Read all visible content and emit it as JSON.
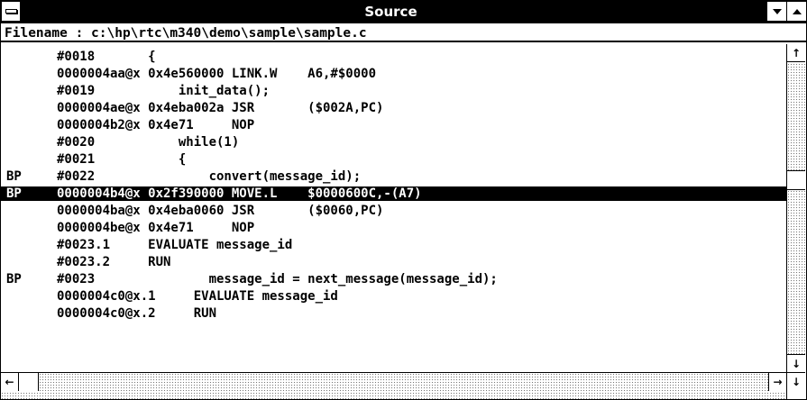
{
  "window": {
    "title": "Source"
  },
  "header": {
    "filename_label": "Filename : c:\\hp\\rtc\\m340\\demo\\sample\\sample.c"
  },
  "lines": [
    {
      "bp": "",
      "text": "#0018       {",
      "highlight": false
    },
    {
      "bp": "",
      "text": "0000004aa@x 0x4e560000 LINK.W    A6,#$0000",
      "highlight": false
    },
    {
      "bp": "",
      "text": "#0019           init_data();",
      "highlight": false
    },
    {
      "bp": "",
      "text": "0000004ae@x 0x4eba002a JSR       ($002A,PC)",
      "highlight": false
    },
    {
      "bp": "",
      "text": "0000004b2@x 0x4e71     NOP",
      "highlight": false
    },
    {
      "bp": "",
      "text": "#0020           while(1)",
      "highlight": false
    },
    {
      "bp": "",
      "text": "#0021           {",
      "highlight": false
    },
    {
      "bp": "BP",
      "text": "#0022               convert(message_id);",
      "highlight": false
    },
    {
      "bp": "BP",
      "text": "0000004b4@x 0x2f390000 MOVE.L    $0000600C,-(A7)",
      "highlight": true
    },
    {
      "bp": "",
      "text": "0000004ba@x 0x4eba0060 JSR       ($0060,PC)",
      "highlight": false
    },
    {
      "bp": "",
      "text": "0000004be@x 0x4e71     NOP",
      "highlight": false
    },
    {
      "bp": "",
      "text": "#0023.1     EVALUATE message_id",
      "highlight": false
    },
    {
      "bp": "",
      "text": "#0023.2     RUN",
      "highlight": false
    },
    {
      "bp": "BP",
      "text": "#0023               message_id = next_message(message_id);",
      "highlight": false
    },
    {
      "bp": "",
      "text": "0000004c0@x.1     EVALUATE message_id",
      "highlight": false
    },
    {
      "bp": "",
      "text": "0000004c0@x.2     RUN",
      "highlight": false
    }
  ],
  "icons": {
    "system_menu": "system-menu-icon",
    "minimize": "minimize-icon",
    "maximize": "maximize-icon",
    "scroll_up": "arrow-up-icon",
    "scroll_down": "arrow-down-icon",
    "scroll_left": "arrow-left-icon",
    "scroll_right": "arrow-right-icon"
  },
  "colors": {
    "title_bg": "#000000",
    "title_fg": "#ffffff",
    "highlight_bg": "#000000",
    "highlight_fg": "#ffffff"
  }
}
